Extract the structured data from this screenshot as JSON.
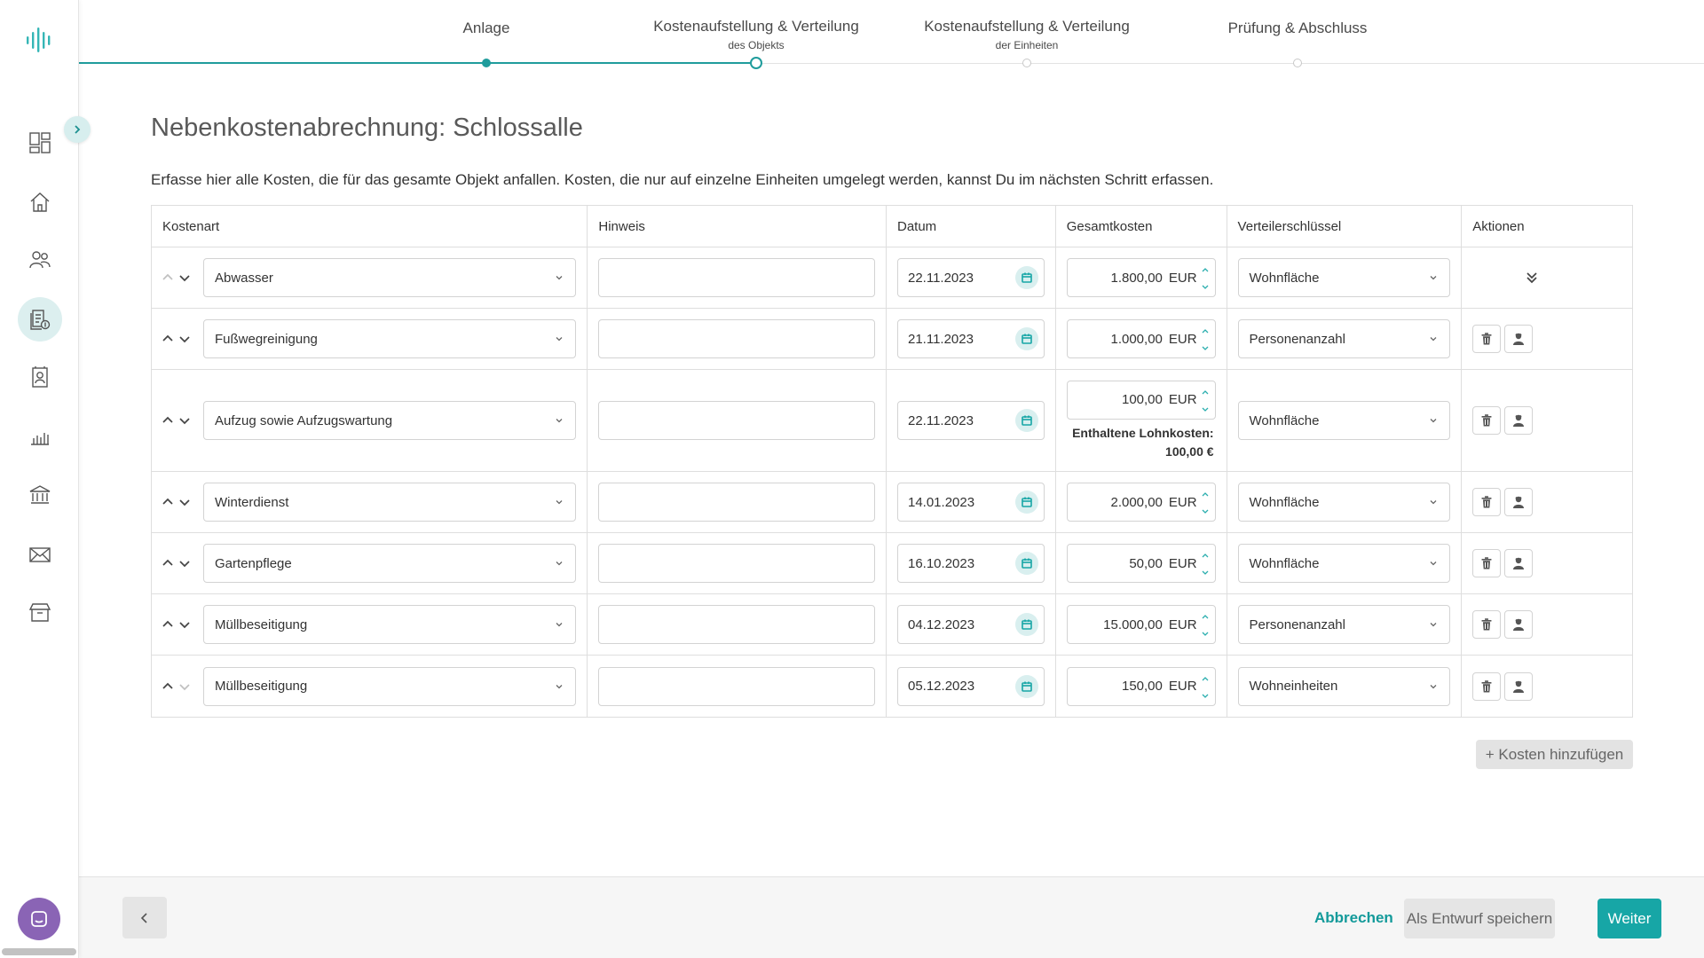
{
  "colors": {
    "accent": "#17a6a6",
    "active_nav_bg": "#dcefef",
    "chat_button": "#8a64b5"
  },
  "sidebar": {
    "logo_icon": "bars-logo-icon",
    "items": [
      {
        "icon": "dashboard-icon"
      },
      {
        "icon": "home-icon"
      },
      {
        "icon": "people-icon"
      },
      {
        "icon": "billing-icon",
        "active": true
      },
      {
        "icon": "contacts-icon"
      },
      {
        "icon": "bar-chart-icon"
      },
      {
        "icon": "bank-icon"
      },
      {
        "icon": "mail-icon"
      },
      {
        "icon": "archive-icon"
      }
    ]
  },
  "stepper": {
    "steps": [
      {
        "label": "Anlage",
        "sub": "",
        "state": "done"
      },
      {
        "label": "Kostenaufstellung & Verteilung",
        "sub": "des Objekts",
        "state": "current"
      },
      {
        "label": "Kostenaufstellung & Verteilung",
        "sub": "der Einheiten",
        "state": "upcoming"
      },
      {
        "label": "Prüfung & Abschluss",
        "sub": "",
        "state": "upcoming"
      }
    ]
  },
  "page": {
    "title": "Nebenkostenabrechnung: Schlossalle",
    "intro": "Erfasse hier alle Kosten, die für das gesamte Objekt anfallen. Kosten, die nur auf einzelne Einheiten umgelegt werden, kannst Du im nächsten Schritt erfassen."
  },
  "table": {
    "headers": [
      "Kostenart",
      "Hinweis",
      "Datum",
      "Gesamtkosten",
      "Verteilerschlüssel",
      "Aktionen"
    ],
    "currency": "EUR",
    "rows": [
      {
        "kostenart": "Abwasser",
        "hinweis": "",
        "datum": "22.11.2023",
        "betrag": "1.800,00",
        "schluessel": "Wohnfläche",
        "up_enabled": false,
        "down_enabled": true,
        "actions": "expand"
      },
      {
        "kostenart": "Fußwegreinigung",
        "hinweis": "",
        "datum": "21.11.2023",
        "betrag": "1.000,00",
        "schluessel": "Personenanzahl",
        "up_enabled": true,
        "down_enabled": true,
        "actions": "buttons"
      },
      {
        "kostenart": "Aufzug sowie Aufzugswartung",
        "hinweis": "",
        "datum": "22.11.2023",
        "betrag": "100,00",
        "schluessel": "Wohnfläche",
        "up_enabled": true,
        "down_enabled": true,
        "actions": "buttons",
        "wage_label": "Enthaltene Lohnkosten:",
        "wage_value": "100,00 €"
      },
      {
        "kostenart": "Winterdienst",
        "hinweis": "",
        "datum": "14.01.2023",
        "betrag": "2.000,00",
        "schluessel": "Wohnfläche",
        "up_enabled": true,
        "down_enabled": true,
        "actions": "buttons"
      },
      {
        "kostenart": "Gartenpflege",
        "hinweis": "",
        "datum": "16.10.2023",
        "betrag": "50,00",
        "schluessel": "Wohnfläche",
        "up_enabled": true,
        "down_enabled": true,
        "actions": "buttons"
      },
      {
        "kostenart": "Müllbeseitigung",
        "hinweis": "",
        "datum": "04.12.2023",
        "betrag": "15.000,00",
        "schluessel": "Personenanzahl",
        "up_enabled": true,
        "down_enabled": true,
        "actions": "buttons"
      },
      {
        "kostenart": "Müllbeseitigung",
        "hinweis": "",
        "datum": "05.12.2023",
        "betrag": "150,00",
        "schluessel": "Wohneinheiten",
        "up_enabled": true,
        "down_enabled": false,
        "actions": "buttons"
      }
    ],
    "add_label": "+ Kosten hinzufügen"
  },
  "footer": {
    "back_icon": "chevron-left-icon",
    "cancel_label": "Abbrechen",
    "draft_label": "Als Entwurf speichern",
    "next_label": "Weiter"
  }
}
